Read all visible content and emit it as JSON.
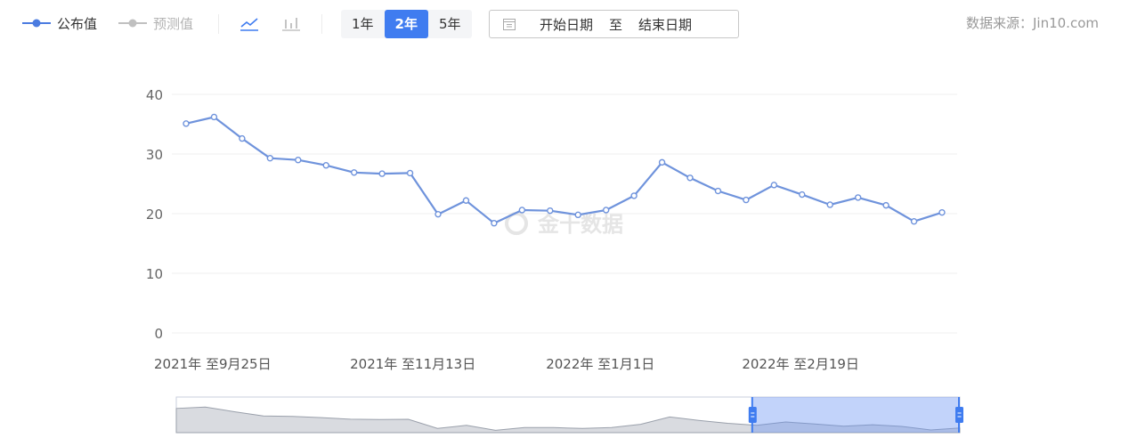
{
  "legend": {
    "published_label": "公布值",
    "forecast_label": "预测值",
    "published_color": "#4a7be0",
    "forecast_color": "#c0c0c0"
  },
  "chart_buttons": [
    {
      "name": "line-chart-icon",
      "active": true
    },
    {
      "name": "bar-chart-icon",
      "active": false
    }
  ],
  "range_buttons": [
    {
      "label": "1年",
      "active": false
    },
    {
      "label": "2年",
      "active": true
    },
    {
      "label": "5年",
      "active": false
    }
  ],
  "date_range": {
    "start_placeholder": "开始日期",
    "separator": "至",
    "end_placeholder": "结束日期"
  },
  "source_text": "数据来源：Jin10.com",
  "watermark_text": "金十数据",
  "chart_data": {
    "type": "line",
    "title": "",
    "xlabel": "",
    "ylabel": "",
    "ylim": [
      0,
      40
    ],
    "y_ticks": [
      0,
      10,
      20,
      30,
      40
    ],
    "x_tick_labels": [
      "2021年 至9月25日",
      "2021年 至11月13日",
      "2022年 至1月1日",
      "2022年 至2月19日"
    ],
    "x_tick_indices": [
      0,
      7,
      14,
      21
    ],
    "grid": true,
    "line_color": "#6f93dc",
    "series": [
      {
        "name": "公布值",
        "values": [
          35.1,
          36.2,
          32.6,
          29.3,
          29.0,
          28.1,
          26.9,
          26.7,
          26.8,
          19.9,
          22.2,
          18.4,
          20.6,
          20.5,
          19.8,
          20.6,
          23.0,
          28.6,
          26.0,
          23.8,
          22.3,
          24.8,
          23.2,
          21.5,
          22.7,
          21.4,
          18.7,
          20.2
        ]
      }
    ]
  },
  "navigator": {
    "selection_start": 0.735,
    "selection_end": 1.0,
    "overview_values": [
      35.1,
      36.2,
      32.6,
      29.3,
      29.0,
      28.1,
      26.9,
      26.7,
      26.8,
      19.9,
      22.2,
      18.4,
      20.6,
      20.5,
      19.8,
      20.6,
      23.0,
      28.6,
      26.0,
      23.8,
      22.3,
      24.8,
      23.2,
      21.5,
      22.7,
      21.4,
      18.7,
      20.2
    ]
  }
}
